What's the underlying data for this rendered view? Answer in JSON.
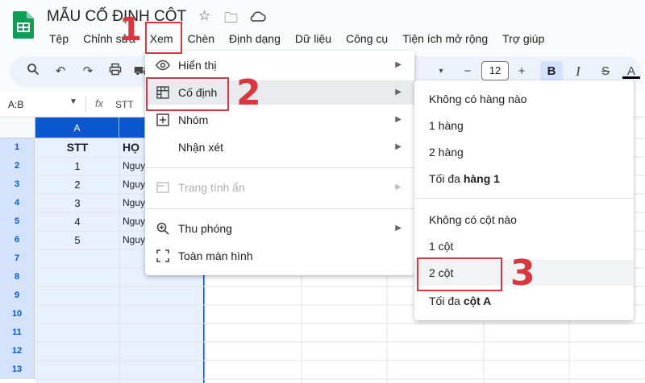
{
  "app": {
    "doc_title": "MẪU CỐ ĐỊNH CỘT"
  },
  "menubar": {
    "items": [
      "Tệp",
      "Chỉnh sửa",
      "Xem",
      "Chèn",
      "Định dạng",
      "Dữ liệu",
      "Công cụ",
      "Tiện ích mở rộng",
      "Trợ giúp"
    ]
  },
  "toolbar": {
    "font_size": "12",
    "bold": "B",
    "italic": "I",
    "strike": "S",
    "underline_a": "A"
  },
  "formula_bar": {
    "name_box": "A:B",
    "fx": "fx",
    "value": "STT"
  },
  "grid": {
    "col_a": "A",
    "rows": [
      "1",
      "2",
      "3",
      "4",
      "5",
      "6",
      "7",
      "8",
      "9",
      "10",
      "11",
      "12",
      "13"
    ],
    "header": {
      "stt": "STT",
      "ho": "HỌ"
    },
    "stt_values": [
      "1",
      "2",
      "3",
      "4",
      "5"
    ],
    "name_values": [
      "Nguy",
      "Nguy",
      "Nguy",
      "Nguy",
      "Nguy"
    ]
  },
  "view_menu": {
    "items": [
      {
        "icon": "eye-icon",
        "label": "Hiển thị"
      },
      {
        "icon": "freeze-icon",
        "label": "Cố định"
      },
      {
        "icon": "group-icon",
        "label": "Nhóm"
      },
      {
        "icon": "",
        "label": "Nhận xét"
      },
      {
        "icon": "hidden-sheet-icon",
        "label": "Trang tính ẩn"
      },
      {
        "icon": "zoom-icon",
        "label": "Thu phóng"
      },
      {
        "icon": "fullscreen-icon",
        "label": "Toàn màn hình"
      }
    ]
  },
  "freeze_submenu": {
    "no_rows": "Không có hàng nào",
    "one_row": "1 hàng",
    "two_rows": "2 hàng",
    "max_rows_prefix": "Tối đa ",
    "max_rows_bold": "hàng 1",
    "no_cols": "Không có cột nào",
    "one_col": "1 cột",
    "two_cols": "2 cột",
    "max_cols_prefix": "Tối đa ",
    "max_cols_bold": "cột A"
  },
  "annotations": {
    "step1": "1",
    "step2": "2",
    "step3": "3"
  },
  "colors": {
    "accent": "#0b57d0",
    "annotation": "#d9363e",
    "sheets_green": "#0f9d58"
  }
}
